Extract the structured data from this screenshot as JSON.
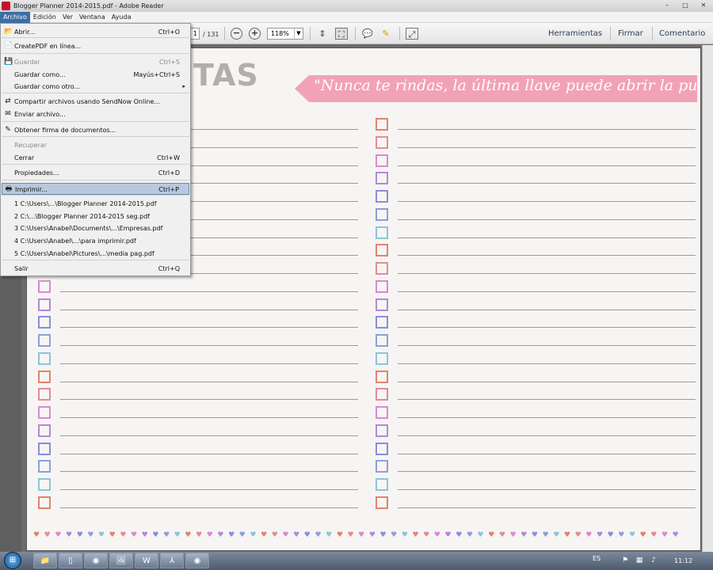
{
  "window": {
    "title": "Blogger Planner 2014-2015.pdf - Adobe Reader",
    "min": "–",
    "max": "□",
    "close": "✕"
  },
  "menubar": [
    "Archivo",
    "Edición",
    "Ver",
    "Ventana",
    "Ayuda"
  ],
  "toolbar": {
    "page_current": "1",
    "page_total": "/ 131",
    "zoom": "118%",
    "zoom_out": "−",
    "zoom_in": "+",
    "herramientas": "Herramientas",
    "firmar": "Firmar",
    "comentario": "Comentario"
  },
  "file_menu": {
    "items": [
      {
        "label": "Abrir...",
        "shortcut": "Ctrl+O",
        "icon": "open-folder-icon",
        "glyph": "📂",
        "disabled": false
      },
      {
        "label": "CreatePDF en línea...",
        "shortcut": "",
        "icon": "create-pdf-icon",
        "glyph": "📄",
        "disabled": false
      },
      {
        "label": "Guardar",
        "shortcut": "Ctrl+S",
        "icon": "save-icon",
        "glyph": "💾",
        "disabled": true
      },
      {
        "label": "Guardar como...",
        "shortcut": "Mayús+Ctrl+S",
        "icon": "",
        "glyph": "",
        "disabled": false
      },
      {
        "label": "Guardar como otro...",
        "shortcut": "",
        "icon": "",
        "glyph": "",
        "disabled": false,
        "submenu": true
      },
      {
        "label": "Compartir archivos usando SendNow Online...",
        "shortcut": "",
        "icon": "share-icon",
        "glyph": "⇄",
        "disabled": false
      },
      {
        "label": "Enviar archivo...",
        "shortcut": "",
        "icon": "mail-icon",
        "glyph": "✉",
        "disabled": false
      },
      {
        "label": "Obtener firma de documentos...",
        "shortcut": "",
        "icon": "sign-icon",
        "glyph": "✎",
        "disabled": false
      },
      {
        "label": "Recuperar",
        "shortcut": "",
        "icon": "",
        "glyph": "",
        "disabled": true
      },
      {
        "label": "Cerrar",
        "shortcut": "Ctrl+W",
        "icon": "",
        "glyph": "",
        "disabled": false
      },
      {
        "label": "Propiedades...",
        "shortcut": "Ctrl+D",
        "icon": "",
        "glyph": "",
        "disabled": false
      },
      {
        "label": "Imprimir...",
        "shortcut": "Ctrl+P",
        "icon": "printer-icon",
        "glyph": "🖶",
        "disabled": false,
        "highlighted": true
      },
      {
        "label": "1 C:\\Users\\...\\Blogger Planner 2014-2015.pdf",
        "shortcut": "",
        "icon": "",
        "glyph": "",
        "disabled": false
      },
      {
        "label": "2 C:\\...\\Blogger Planner 2014-2015 seg.pdf",
        "shortcut": "",
        "icon": "",
        "glyph": "",
        "disabled": false
      },
      {
        "label": "3 C:\\Users\\Anabel\\Documents\\...\\Empresas.pdf",
        "shortcut": "",
        "icon": "",
        "glyph": "",
        "disabled": false
      },
      {
        "label": "4 C:\\Users\\Anabel\\...\\para imprimir.pdf",
        "shortcut": "",
        "icon": "",
        "glyph": "",
        "disabled": false
      },
      {
        "label": "5 C:\\Users\\Anabel\\Pictures\\...\\media pag.pdf",
        "shortcut": "",
        "icon": "",
        "glyph": "",
        "disabled": false
      },
      {
        "label": "Salir",
        "shortcut": "Ctrl+Q",
        "icon": "",
        "glyph": "",
        "disabled": false
      }
    ]
  },
  "document": {
    "title_partial": "TAS",
    "quote": "\"Nunca te rindas, la última llave puede abrir la puerta.\"",
    "checkbox_colors": [
      "#e2836f",
      "#e38a9a",
      "#d98ad0",
      "#b08ad9",
      "#8a8dd9",
      "#8aa0d9",
      "#8ac6d9"
    ],
    "hearts": "♥♥♥♥♥♥♥♥♥♥♥♥♥♥♥♥♥♥♥♥♥♥♥♥♥♥♥♥♥♥♥♥♥♥♥♥♥♥♥♥♥♥♥♥♥♥♥♥♥♥♥♥♥♥♥♥♥♥♥♥"
  },
  "taskbar": {
    "start": "⊞",
    "apps": [
      {
        "name": "explorer-app",
        "glyph": "📁"
      },
      {
        "name": "blank-app",
        "glyph": "▯"
      },
      {
        "name": "chrome-app",
        "glyph": "◉"
      },
      {
        "name": "photos-app",
        "glyph": "🖼"
      },
      {
        "name": "word-app",
        "glyph": "W"
      },
      {
        "name": "acrobat-app",
        "glyph": "⅄"
      },
      {
        "name": "record-app",
        "glyph": "◉"
      }
    ],
    "lang": "ES",
    "time": "11:12"
  }
}
